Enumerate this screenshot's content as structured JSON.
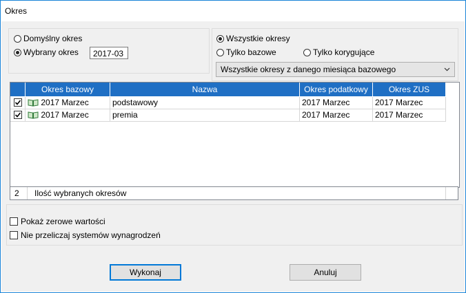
{
  "window": {
    "title": "Okres"
  },
  "period_selector": {
    "default_label": "Domyślny  okres",
    "selected_label": "Wybrany okres",
    "selected_value": "2017-03"
  },
  "filter": {
    "all_label": "Wszystkie okresy",
    "base_only_label": "Tylko bazowe",
    "corrective_only_label": "Tylko korygujące",
    "dropdown_value": "Wszystkie okresy z danego miesiąca bazowego"
  },
  "table": {
    "columns": [
      "Okres bazowy",
      "Nazwa",
      "Okres podatkowy",
      "Okres ZUS"
    ],
    "rows": [
      {
        "checked": true,
        "base": "2017 Marzec",
        "name": "podstawowy",
        "tax": "2017 Marzec",
        "zus": "2017 Marzec"
      },
      {
        "checked": true,
        "base": "2017 Marzec",
        "name": "premia",
        "tax": "2017 Marzec",
        "zus": "2017 Marzec"
      }
    ]
  },
  "summary": {
    "count": "2",
    "label": "Ilość wybranych okresów"
  },
  "options": {
    "show_zero_label": "Pokaż zerowe wartości",
    "no_recalc_label": "Nie przeliczaj systemów wynagrodzeń"
  },
  "buttons": {
    "execute": "Wykonaj",
    "cancel": "Anuluj"
  }
}
